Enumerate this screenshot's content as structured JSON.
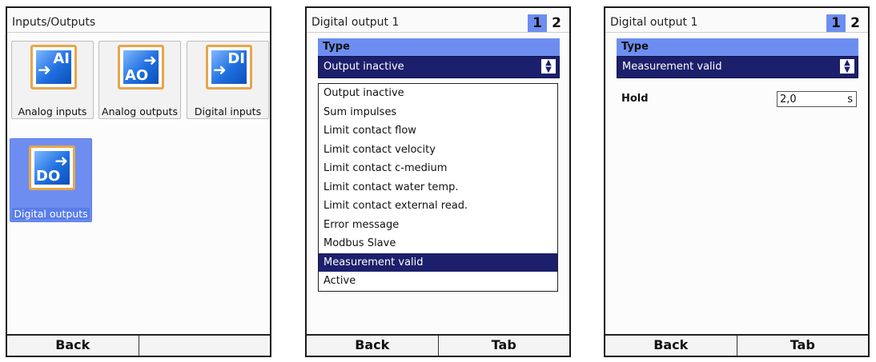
{
  "panel1": {
    "title": "Inputs/Outputs",
    "tiles": [
      {
        "label": "Analog inputs",
        "icon": "analog-input-icon",
        "abbr": "AI"
      },
      {
        "label": "Analog outputs",
        "icon": "analog-output-icon",
        "abbr": "AO"
      },
      {
        "label": "Digital inputs",
        "icon": "digital-input-icon",
        "abbr": "DI"
      },
      {
        "label": "Digital outputs",
        "icon": "digital-output-icon",
        "abbr": "DO",
        "selected": true
      }
    ],
    "footer": {
      "left": "Back",
      "right": ""
    }
  },
  "panel2": {
    "title": "Digital output 1",
    "pages": [
      "1",
      "2"
    ],
    "type_label": "Type",
    "selected_value": "Output inactive",
    "options": [
      "Output inactive",
      "Sum impulses",
      "Limit contact flow",
      "Limit contact velocity",
      "Limit contact c-medium",
      "Limit contact water temp.",
      "Limit contact external read.",
      "Error message",
      "Modbus Slave",
      "Measurement valid",
      "Active"
    ],
    "highlighted_option": "Measurement valid",
    "footer": {
      "left": "Back",
      "right": "Tab"
    }
  },
  "panel3": {
    "title": "Digital output 1",
    "pages": [
      "1",
      "2"
    ],
    "type_label": "Type",
    "selected_value": "Measurement valid",
    "hold": {
      "label": "Hold",
      "value": "2,0",
      "unit": "s"
    },
    "footer": {
      "left": "Back",
      "right": "Tab"
    }
  },
  "colors": {
    "accent": "#6d8ef0",
    "select_bg": "#1c1f6b",
    "icon_frame": "#e8a54a",
    "icon_fill": "#1f6fe0"
  }
}
